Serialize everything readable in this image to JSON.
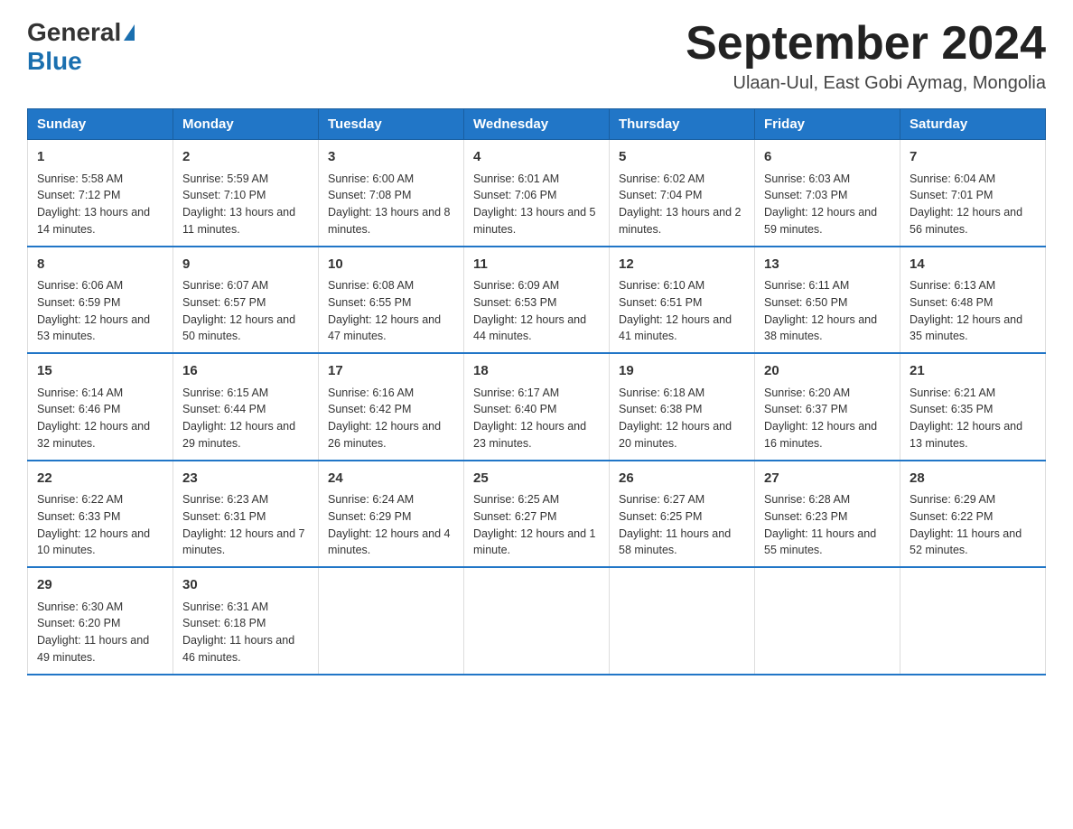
{
  "header": {
    "logo_general": "General",
    "logo_blue": "Blue",
    "month_title": "September 2024",
    "location": "Ulaan-Uul, East Gobi Aymag, Mongolia"
  },
  "days_of_week": [
    "Sunday",
    "Monday",
    "Tuesday",
    "Wednesday",
    "Thursday",
    "Friday",
    "Saturday"
  ],
  "weeks": [
    [
      {
        "day": "1",
        "sunrise": "Sunrise: 5:58 AM",
        "sunset": "Sunset: 7:12 PM",
        "daylight": "Daylight: 13 hours and 14 minutes."
      },
      {
        "day": "2",
        "sunrise": "Sunrise: 5:59 AM",
        "sunset": "Sunset: 7:10 PM",
        "daylight": "Daylight: 13 hours and 11 minutes."
      },
      {
        "day": "3",
        "sunrise": "Sunrise: 6:00 AM",
        "sunset": "Sunset: 7:08 PM",
        "daylight": "Daylight: 13 hours and 8 minutes."
      },
      {
        "day": "4",
        "sunrise": "Sunrise: 6:01 AM",
        "sunset": "Sunset: 7:06 PM",
        "daylight": "Daylight: 13 hours and 5 minutes."
      },
      {
        "day": "5",
        "sunrise": "Sunrise: 6:02 AM",
        "sunset": "Sunset: 7:04 PM",
        "daylight": "Daylight: 13 hours and 2 minutes."
      },
      {
        "day": "6",
        "sunrise": "Sunrise: 6:03 AM",
        "sunset": "Sunset: 7:03 PM",
        "daylight": "Daylight: 12 hours and 59 minutes."
      },
      {
        "day": "7",
        "sunrise": "Sunrise: 6:04 AM",
        "sunset": "Sunset: 7:01 PM",
        "daylight": "Daylight: 12 hours and 56 minutes."
      }
    ],
    [
      {
        "day": "8",
        "sunrise": "Sunrise: 6:06 AM",
        "sunset": "Sunset: 6:59 PM",
        "daylight": "Daylight: 12 hours and 53 minutes."
      },
      {
        "day": "9",
        "sunrise": "Sunrise: 6:07 AM",
        "sunset": "Sunset: 6:57 PM",
        "daylight": "Daylight: 12 hours and 50 minutes."
      },
      {
        "day": "10",
        "sunrise": "Sunrise: 6:08 AM",
        "sunset": "Sunset: 6:55 PM",
        "daylight": "Daylight: 12 hours and 47 minutes."
      },
      {
        "day": "11",
        "sunrise": "Sunrise: 6:09 AM",
        "sunset": "Sunset: 6:53 PM",
        "daylight": "Daylight: 12 hours and 44 minutes."
      },
      {
        "day": "12",
        "sunrise": "Sunrise: 6:10 AM",
        "sunset": "Sunset: 6:51 PM",
        "daylight": "Daylight: 12 hours and 41 minutes."
      },
      {
        "day": "13",
        "sunrise": "Sunrise: 6:11 AM",
        "sunset": "Sunset: 6:50 PM",
        "daylight": "Daylight: 12 hours and 38 minutes."
      },
      {
        "day": "14",
        "sunrise": "Sunrise: 6:13 AM",
        "sunset": "Sunset: 6:48 PM",
        "daylight": "Daylight: 12 hours and 35 minutes."
      }
    ],
    [
      {
        "day": "15",
        "sunrise": "Sunrise: 6:14 AM",
        "sunset": "Sunset: 6:46 PM",
        "daylight": "Daylight: 12 hours and 32 minutes."
      },
      {
        "day": "16",
        "sunrise": "Sunrise: 6:15 AM",
        "sunset": "Sunset: 6:44 PM",
        "daylight": "Daylight: 12 hours and 29 minutes."
      },
      {
        "day": "17",
        "sunrise": "Sunrise: 6:16 AM",
        "sunset": "Sunset: 6:42 PM",
        "daylight": "Daylight: 12 hours and 26 minutes."
      },
      {
        "day": "18",
        "sunrise": "Sunrise: 6:17 AM",
        "sunset": "Sunset: 6:40 PM",
        "daylight": "Daylight: 12 hours and 23 minutes."
      },
      {
        "day": "19",
        "sunrise": "Sunrise: 6:18 AM",
        "sunset": "Sunset: 6:38 PM",
        "daylight": "Daylight: 12 hours and 20 minutes."
      },
      {
        "day": "20",
        "sunrise": "Sunrise: 6:20 AM",
        "sunset": "Sunset: 6:37 PM",
        "daylight": "Daylight: 12 hours and 16 minutes."
      },
      {
        "day": "21",
        "sunrise": "Sunrise: 6:21 AM",
        "sunset": "Sunset: 6:35 PM",
        "daylight": "Daylight: 12 hours and 13 minutes."
      }
    ],
    [
      {
        "day": "22",
        "sunrise": "Sunrise: 6:22 AM",
        "sunset": "Sunset: 6:33 PM",
        "daylight": "Daylight: 12 hours and 10 minutes."
      },
      {
        "day": "23",
        "sunrise": "Sunrise: 6:23 AM",
        "sunset": "Sunset: 6:31 PM",
        "daylight": "Daylight: 12 hours and 7 minutes."
      },
      {
        "day": "24",
        "sunrise": "Sunrise: 6:24 AM",
        "sunset": "Sunset: 6:29 PM",
        "daylight": "Daylight: 12 hours and 4 minutes."
      },
      {
        "day": "25",
        "sunrise": "Sunrise: 6:25 AM",
        "sunset": "Sunset: 6:27 PM",
        "daylight": "Daylight: 12 hours and 1 minute."
      },
      {
        "day": "26",
        "sunrise": "Sunrise: 6:27 AM",
        "sunset": "Sunset: 6:25 PM",
        "daylight": "Daylight: 11 hours and 58 minutes."
      },
      {
        "day": "27",
        "sunrise": "Sunrise: 6:28 AM",
        "sunset": "Sunset: 6:23 PM",
        "daylight": "Daylight: 11 hours and 55 minutes."
      },
      {
        "day": "28",
        "sunrise": "Sunrise: 6:29 AM",
        "sunset": "Sunset: 6:22 PM",
        "daylight": "Daylight: 11 hours and 52 minutes."
      }
    ],
    [
      {
        "day": "29",
        "sunrise": "Sunrise: 6:30 AM",
        "sunset": "Sunset: 6:20 PM",
        "daylight": "Daylight: 11 hours and 49 minutes."
      },
      {
        "day": "30",
        "sunrise": "Sunrise: 6:31 AM",
        "sunset": "Sunset: 6:18 PM",
        "daylight": "Daylight: 11 hours and 46 minutes."
      },
      {
        "day": "",
        "sunrise": "",
        "sunset": "",
        "daylight": ""
      },
      {
        "day": "",
        "sunrise": "",
        "sunset": "",
        "daylight": ""
      },
      {
        "day": "",
        "sunrise": "",
        "sunset": "",
        "daylight": ""
      },
      {
        "day": "",
        "sunrise": "",
        "sunset": "",
        "daylight": ""
      },
      {
        "day": "",
        "sunrise": "",
        "sunset": "",
        "daylight": ""
      }
    ]
  ]
}
